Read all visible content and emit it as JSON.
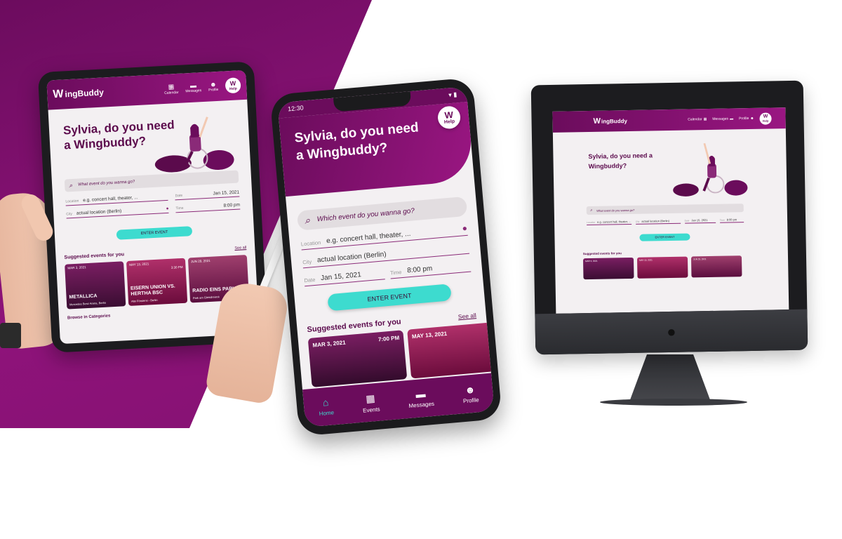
{
  "brand": {
    "logo_mark": "W",
    "logo_text": "ingBuddy",
    "colors": {
      "primary": "#6b0c5c",
      "primary_light": "#9a1682",
      "accent": "#3ddbcf",
      "background": "#f3f0f2"
    }
  },
  "tablet": {
    "nav": {
      "calendar": "Calendar",
      "messages": "Messages",
      "profile": "Profile",
      "help": "Help"
    },
    "hero_title": "Sylvia, do you need a Wingbuddy?",
    "search_placeholder": "What event do you wanna go?",
    "location_label": "Location",
    "location_value": "e.g. concert hall, theater, ...",
    "date_label": "Date",
    "date_value": "Jan 15, 2021",
    "city_label": "City",
    "city_value": "actual location (Berlin)",
    "time_label": "Time",
    "time_value": "8:00 pm",
    "enter_button": "ENTER EVENT",
    "suggested_title": "Suggested events for you",
    "see_all": "See all",
    "cards": [
      {
        "date": "MAR 3, 2021",
        "time": "",
        "title": "METALLICA",
        "place": "Mercedes Benz Arena, Berlin"
      },
      {
        "date": "MAY 13, 2021",
        "time": "3:30 PM",
        "title": "EISERN UNION VS. HERTHA BSC",
        "place": "Alte Försterei - Berlin"
      },
      {
        "date": "JUN 29, 2021",
        "time": "",
        "title": "RADIO EINS PARKFEST",
        "place": "Park am Gleisdreieck"
      }
    ],
    "browse": "Browse in Categories"
  },
  "phone": {
    "status_time": "12:30",
    "help": "Help",
    "hero_title": "Sylvia, do you need a Wingbuddy?",
    "search_placeholder": "Which event do you wanna go?",
    "location_label": "Location",
    "location_value": "e.g. concert hall, theater, ...",
    "city_label": "City",
    "city_value": "actual location (Berlin)",
    "date_label": "Date",
    "date_value": "Jan 15, 2021",
    "time_label": "Time",
    "time_value": "8:00 pm",
    "enter_button": "ENTER EVENT",
    "suggested_title": "Suggested events for you",
    "see_all": "See all",
    "cards": [
      {
        "date": "MAR 3, 2021",
        "time": "7:00 PM"
      },
      {
        "date": "MAY 13, 2021",
        "time": ""
      }
    ],
    "tabs": [
      {
        "label": "Home",
        "icon": "home-icon"
      },
      {
        "label": "Events",
        "icon": "calendar-icon"
      },
      {
        "label": "Messages",
        "icon": "message-icon"
      },
      {
        "label": "Profile",
        "icon": "smiley-icon"
      }
    ]
  },
  "desktop": {
    "nav": {
      "calendar": "Calendar",
      "messages": "Messages",
      "profile": "Profile",
      "help": "Help"
    },
    "hero_title": "Sylvia, do you need a Wingbuddy?",
    "search_placeholder": "What event do you wanna go?",
    "location_label": "Location",
    "location_value": "e.g. concert hall, theater, ...",
    "city_label": "City",
    "city_value": "actual location (Berlin)",
    "date_label": "Date",
    "date_value": "Jan 15, 2021",
    "time_label": "Time",
    "time_value": "8:00 pm",
    "enter_button": "ENTER EVENT",
    "suggested_title": "Suggested events for you",
    "cards": [
      {
        "date": "MAR 3, 2021"
      },
      {
        "date": "MAY 13, 2021"
      },
      {
        "date": "JUN 29, 2021"
      }
    ]
  }
}
